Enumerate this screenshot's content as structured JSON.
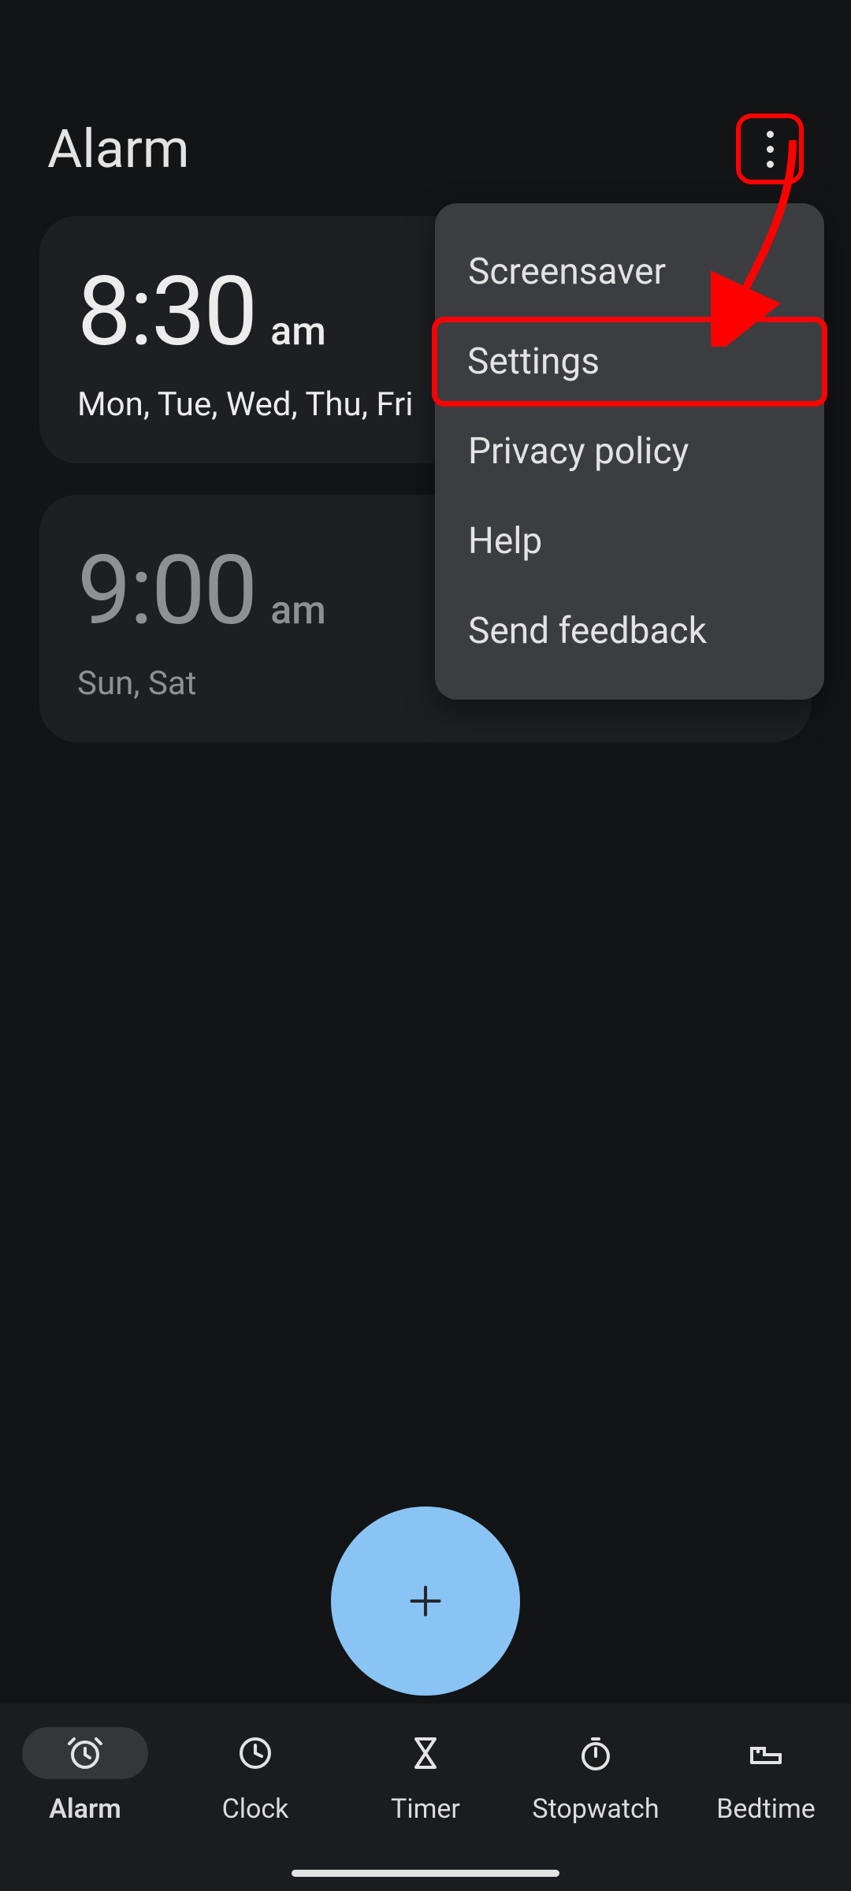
{
  "header": {
    "title": "Alarm"
  },
  "alarms": [
    {
      "time": "8:30",
      "ampm": "am",
      "days": "Mon, Tue, Wed, Thu, Fri",
      "enabled": true
    },
    {
      "time": "9:00",
      "ampm": "am",
      "days": "Sun, Sat",
      "enabled": false
    }
  ],
  "menu": {
    "items": [
      {
        "label": "Screensaver"
      },
      {
        "label": "Settings",
        "highlighted": true
      },
      {
        "label": "Privacy policy"
      },
      {
        "label": "Help"
      },
      {
        "label": "Send feedback"
      }
    ]
  },
  "fab": {
    "icon": "plus"
  },
  "nav": {
    "items": [
      {
        "label": "Alarm",
        "icon": "alarm-icon",
        "active": true
      },
      {
        "label": "Clock",
        "icon": "clock-icon",
        "active": false
      },
      {
        "label": "Timer",
        "icon": "timer-icon",
        "active": false
      },
      {
        "label": "Stopwatch",
        "icon": "stopwatch-icon",
        "active": false
      },
      {
        "label": "Bedtime",
        "icon": "bedtime-icon",
        "active": false
      }
    ]
  },
  "annotation": {
    "highlight_color": "#ff0000"
  }
}
